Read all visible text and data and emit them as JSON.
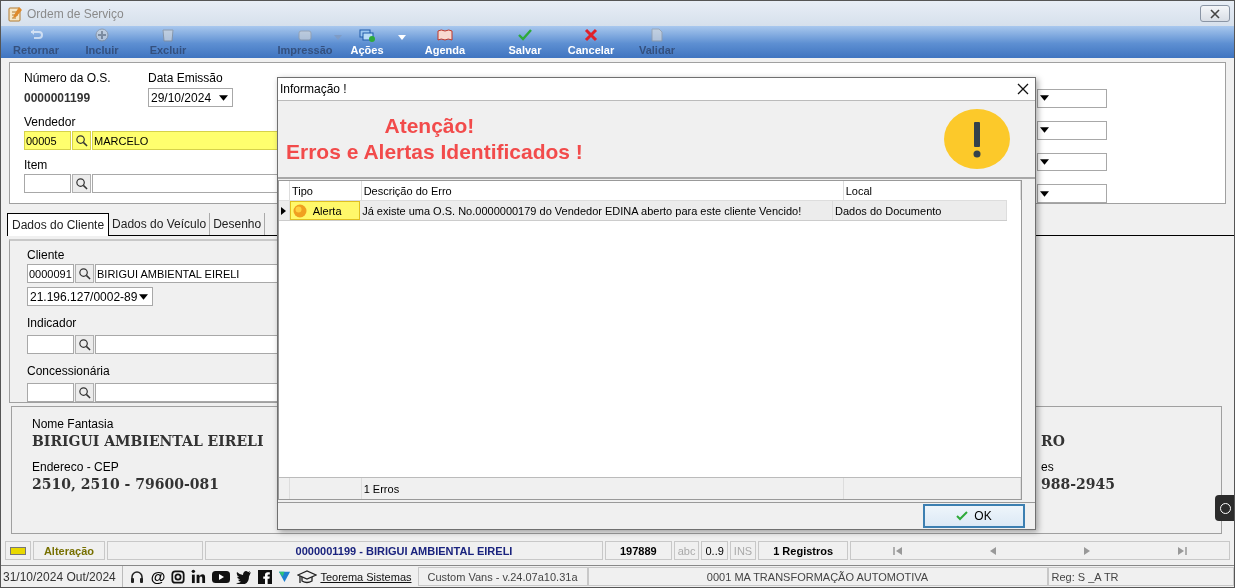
{
  "window": {
    "title": "Ordem de Serviço"
  },
  "toolbar": [
    {
      "label": "Retornar",
      "disabled": true,
      "has_menu": false
    },
    {
      "label": "Incluir",
      "disabled": true,
      "has_menu": false
    },
    {
      "label": "Excluir",
      "disabled": true,
      "has_menu": false
    },
    {
      "label": "Impressão",
      "disabled": true,
      "has_menu": true
    },
    {
      "label": "Ações",
      "disabled": false,
      "has_menu": true
    },
    {
      "label": "Agenda",
      "disabled": false,
      "has_menu": false
    },
    {
      "label": "Salvar",
      "disabled": false,
      "has_menu": false
    },
    {
      "label": "Cancelar",
      "disabled": false,
      "has_menu": false
    },
    {
      "label": "Validar",
      "disabled": true,
      "has_menu": false
    }
  ],
  "header": {
    "os_number_label": "Número da O.S.",
    "os_number": "0000001199",
    "date_label": "Data Emissão",
    "date": "29/10/2024",
    "lookups": [
      {
        "label": "Vendedor",
        "code": "00005",
        "name": "MARCELO",
        "highlighted": true
      },
      {
        "label": "Item",
        "highlighted": false
      }
    ]
  },
  "tabs": [
    {
      "label": "Dados do Cliente",
      "selected": true
    },
    {
      "label": "Dados do Veículo",
      "selected": false
    },
    {
      "label": "Desenho",
      "selected": false
    }
  ],
  "client": {
    "label": "Cliente",
    "code": "0000091",
    "name": "BIRIGUI AMBIENTAL EIRELI",
    "document": "21.196.127/0002-89",
    "lookups": [
      {
        "label": "Indicador"
      },
      {
        "label": "Concessionária"
      }
    ]
  },
  "info": {
    "left": [
      {
        "label": "Nome Fantasia",
        "value": "BIRIGUI AMBIENTAL EIRELI"
      },
      {
        "label": "Endereco - CEP",
        "value": "2510, 2510 - 79600-081"
      }
    ],
    "right": [
      {
        "value": "RO"
      },
      {
        "label": "es",
        "value": "988-2945"
      }
    ]
  },
  "dialog": {
    "title": "Informação !",
    "heading": "Atenção!",
    "subheading": "Erros e Alertas Identificados !",
    "columns": [
      "Tipo",
      "Descrição do Erro",
      "Local"
    ],
    "rows": [
      {
        "type": "Alerta",
        "description": "Já existe uma O.S. No.0000000179 do Vendedor EDINA  aberto para este cliente Vencido!",
        "local": "Dados do Documento",
        "selected": true
      }
    ],
    "footer": "1 Erros",
    "ok": "OK"
  },
  "status_bar": [
    {
      "kind": "icon"
    },
    {
      "kind": "text",
      "text": "Alteração"
    },
    {
      "kind": "blank"
    },
    {
      "kind": "title",
      "text": "0000001199 - BIRIGUI AMBIENTAL EIRELI"
    },
    {
      "kind": "bold",
      "text": "197889"
    },
    {
      "kind": "toggle",
      "text": "abc",
      "disabled": true
    },
    {
      "kind": "toggle",
      "text": "0..9",
      "disabled": false
    },
    {
      "kind": "toggle",
      "text": "INS",
      "disabled": true
    },
    {
      "kind": "bold",
      "text": "1 Registros"
    },
    {
      "kind": "nav"
    }
  ],
  "footer": {
    "date": "31/10/2024 Out/2024",
    "at_sign": "@",
    "link": "Teorema Sistemas",
    "version": "Custom Vans - v.24.07a10.31a",
    "company": "0001 MA TRANSFORMAÇÃO AUTOMOTIVA",
    "reg": "Reg: S _A TR"
  }
}
